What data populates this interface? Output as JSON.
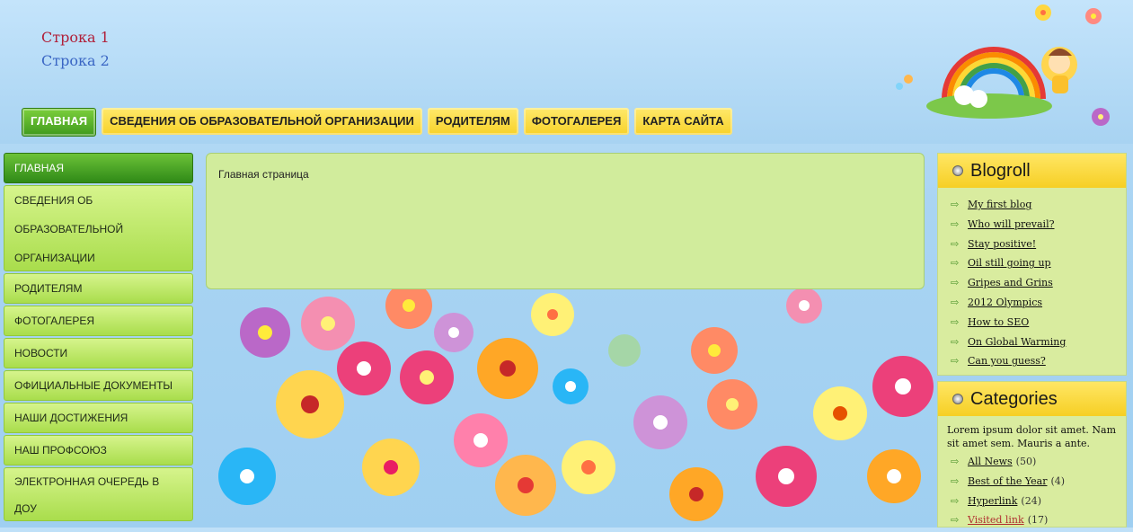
{
  "header": {
    "line1": "Строка 1",
    "line2": "Строка 2"
  },
  "top_nav": [
    {
      "label": "ГЛАВНАЯ",
      "active": true
    },
    {
      "label": "СВЕДЕНИЯ ОБ ОБРАЗОВАТЕЛЬНОЙ ОРГАНИЗАЦИИ",
      "active": false
    },
    {
      "label": "РОДИТЕЛЯМ",
      "active": false
    },
    {
      "label": "ФОТОГАЛЕРЕЯ",
      "active": false
    },
    {
      "label": "КАРТА САЙТА",
      "active": false
    }
  ],
  "sidebar": [
    {
      "label": "ГЛАВНАЯ",
      "active": true
    },
    {
      "label": "СВЕДЕНИЯ ОБ ОБРАЗОВАТЕЛЬНОЙ ОРГАНИЗАЦИИ"
    },
    {
      "label": "РОДИТЕЛЯМ"
    },
    {
      "label": "ФОТОГАЛЕРЕЯ"
    },
    {
      "label": "НОВОСТИ"
    },
    {
      "label": "ОФИЦИАЛЬНЫЕ ДОКУМЕНТЫ"
    },
    {
      "label": "НАШИ ДОСТИЖЕНИЯ"
    },
    {
      "label": "НАШ ПРОФСОЮЗ"
    },
    {
      "label": "ЭЛЕКТРОННАЯ ОЧЕРЕДЬ В ДОУ"
    }
  ],
  "main": {
    "text": "Главная страница"
  },
  "blogroll": {
    "title": "Blogroll",
    "links": [
      "My first blog",
      "Who will prevail?",
      "Stay positive!",
      "Oil still going up",
      "Gripes and Grins",
      "2012 Olympics",
      "How to SEO",
      "On Global Warming",
      "Can you guess?"
    ]
  },
  "categories": {
    "title": "Categories",
    "description": "Lorem ipsum dolor sit amet. Nam sit amet sem. Mauris a ante.",
    "items": [
      {
        "label": "All News",
        "count": "(50)"
      },
      {
        "label": "Best of the Year",
        "count": "(4)"
      },
      {
        "label": "Hyperlink",
        "count": "(24)"
      },
      {
        "label": "Visited link",
        "count": "(17)"
      }
    ]
  },
  "colors": {
    "nav_yellow": "#f7d22a",
    "nav_green": "#3f9a1e",
    "sidebar_green": "#a9dd4c",
    "content_bg": "#d1ec9c"
  }
}
